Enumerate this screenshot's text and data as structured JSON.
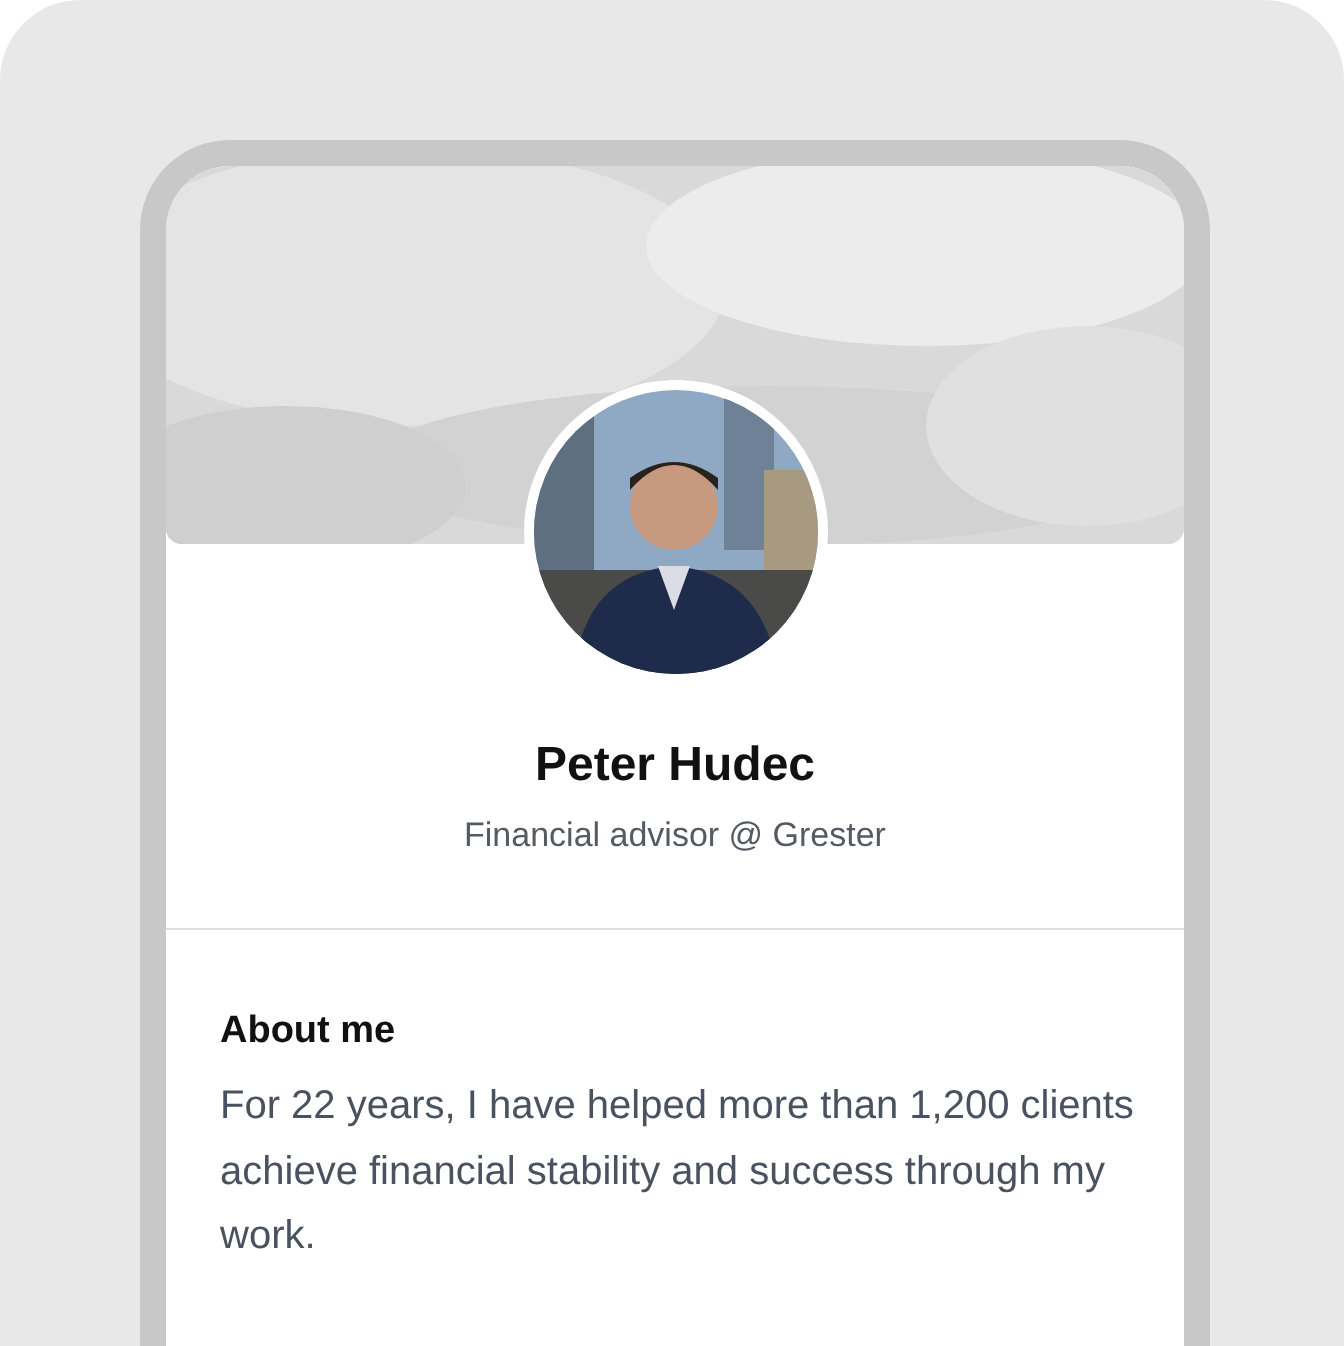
{
  "profile": {
    "name": "Peter Hudec",
    "headline": "Financial advisor @ Grester"
  },
  "about": {
    "title": "About me",
    "text": "For 22 years, I have helped more than 1,200 clients achieve financial stability and success through my work."
  }
}
